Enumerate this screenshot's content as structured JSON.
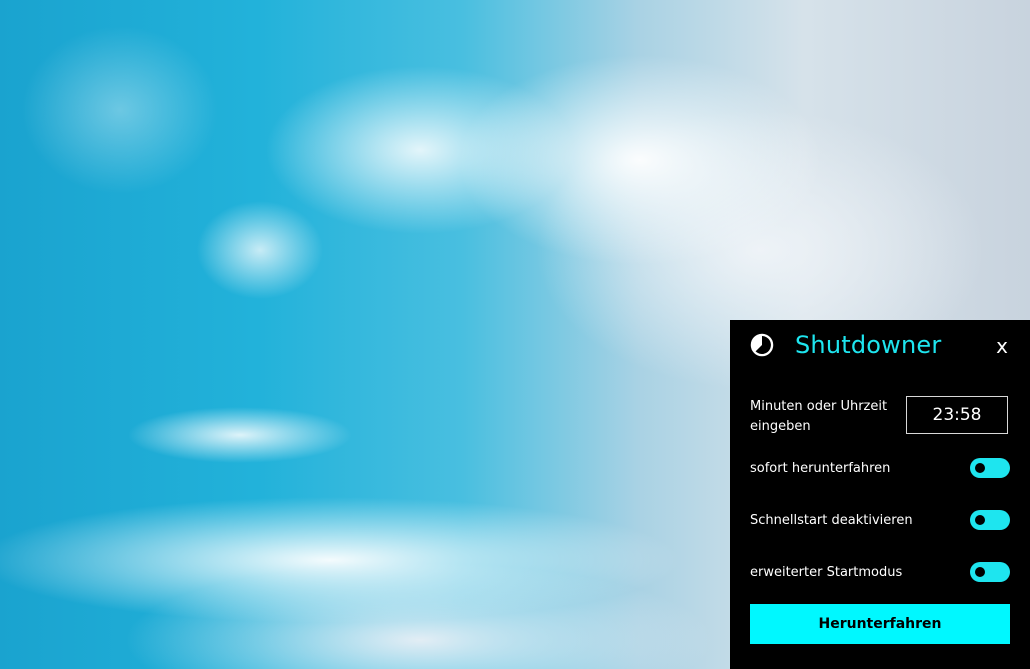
{
  "app": {
    "title": "Shutdowner",
    "icon": "timer-pie-icon",
    "close_label": "x",
    "accent_color": "#1ee5ef"
  },
  "time_entry": {
    "label_line1": "Minuten oder Uhrzeit",
    "label_line2": "eingeben",
    "value": "23:58"
  },
  "options": [
    {
      "label": "sofort herunterfahren",
      "state": "off"
    },
    {
      "label": "Schnellstart deaktivieren",
      "state": "off"
    },
    {
      "label": "erweiterter Startmodus",
      "state": "off"
    }
  ],
  "action": {
    "button_label": "Herunterfahren",
    "color": "#00f8ff"
  }
}
